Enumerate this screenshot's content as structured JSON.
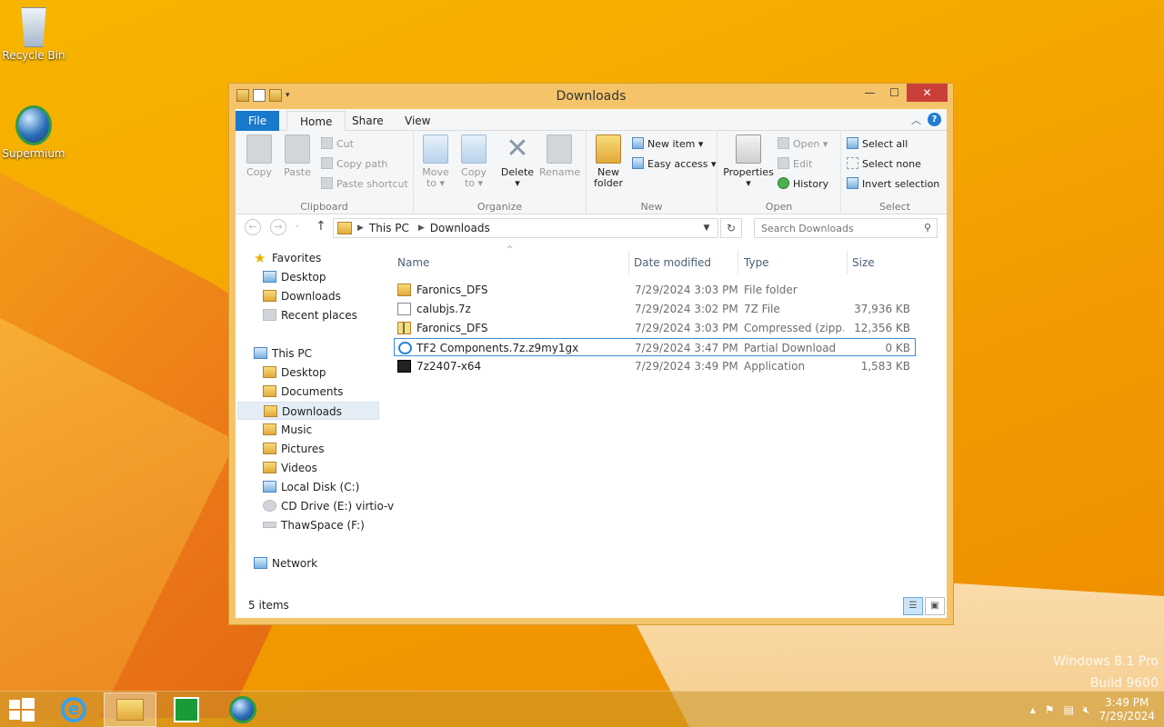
{
  "desktop": {
    "icons": [
      {
        "label": "Recycle Bin"
      },
      {
        "label": "Supermium"
      }
    ],
    "watermark": [
      "Windows 8.1 Pro",
      "Build 9600"
    ]
  },
  "window": {
    "title": "Downloads",
    "buttons": {
      "minimize": "—",
      "maximize": "☐",
      "close": "✕"
    },
    "tabs": {
      "file": "File",
      "home": "Home",
      "share": "Share",
      "view": "View"
    },
    "help": "?",
    "ribbon": {
      "clipboard": {
        "label": "Clipboard",
        "copy": "Copy",
        "paste": "Paste",
        "cut": "Cut",
        "copy_path": "Copy path",
        "paste_shortcut": "Paste shortcut"
      },
      "organize": {
        "label": "Organize",
        "move_to": [
          "Move",
          "to ▾"
        ],
        "copy_to": [
          "Copy",
          "to ▾"
        ],
        "delete": [
          "Delete",
          "▾"
        ],
        "rename": "Rename"
      },
      "new": {
        "label": "New",
        "new_folder": [
          "New",
          "folder"
        ],
        "new_item": "New item ▾",
        "easy_access": "Easy access ▾"
      },
      "open": {
        "label": "Open",
        "properties": [
          "Properties",
          "▾"
        ],
        "open": "Open ▾",
        "edit": "Edit",
        "history": "History"
      },
      "select": {
        "label": "Select",
        "select_all": "Select all",
        "select_none": "Select none",
        "invert": "Invert selection"
      }
    },
    "address": {
      "crumbs": [
        "This PC",
        "Downloads"
      ],
      "search_placeholder": "Search Downloads"
    },
    "nav": {
      "favorites": "Favorites",
      "fav_items": [
        "Desktop",
        "Downloads",
        "Recent places"
      ],
      "this_pc": "This PC",
      "pc_items": [
        "Desktop",
        "Documents",
        "Downloads",
        "Music",
        "Pictures",
        "Videos",
        "Local Disk (C:)",
        "CD Drive (E:) virtio-v",
        "ThawSpace (F:)"
      ],
      "network": "Network"
    },
    "columns": {
      "name": "Name",
      "date": "Date modified",
      "type": "Type",
      "size": "Size"
    },
    "files": [
      {
        "name": "Faronics_DFS",
        "date": "7/29/2024 3:03 PM",
        "type": "File folder",
        "size": "",
        "icon": "folder-icon"
      },
      {
        "name": "calubjs.7z",
        "date": "7/29/2024 3:02 PM",
        "type": "7Z File",
        "size": "37,936 KB",
        "icon": "file-icon"
      },
      {
        "name": "Faronics_DFS",
        "date": "7/29/2024 3:03 PM",
        "type": "Compressed (zipp...",
        "size": "12,356 KB",
        "icon": "zip-folder-icon"
      },
      {
        "name": "TF2 Components.7z.z9my1gx",
        "date": "7/29/2024 3:47 PM",
        "type": "Partial Download",
        "size": "0 KB",
        "icon": "ie-download-icon"
      },
      {
        "name": "7z2407-x64",
        "date": "7/29/2024 3:49 PM",
        "type": "Application",
        "size": "1,583 KB",
        "icon": "7zip-app-icon"
      }
    ],
    "status": "5 items"
  },
  "taskbar": {
    "clock_time": "3:49 PM",
    "clock_date": "7/29/2024",
    "tray_arrow": "▴"
  }
}
